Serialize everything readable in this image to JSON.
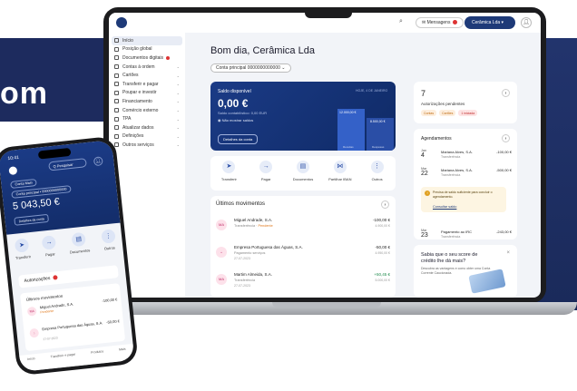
{
  "hero_text": "om",
  "topbar": {
    "search_icon": "search-icon",
    "messages_label": "Mensagens",
    "account_label": "Cerâmica Lda",
    "user_icon": "user-icon"
  },
  "sidebar": {
    "items": [
      {
        "label": "Início",
        "icon": "home-icon"
      },
      {
        "label": "Posição global",
        "icon": "globe-icon"
      },
      {
        "label": "Documentos digitais",
        "icon": "document-icon",
        "badge": true
      },
      {
        "label": "Contas à ordem",
        "icon": "bank-icon",
        "chevron": true
      },
      {
        "label": "Cartões",
        "icon": "card-icon",
        "chevron": true
      },
      {
        "label": "Transferir e pagar",
        "icon": "transfer-icon",
        "chevron": true
      },
      {
        "label": "Poupar e investir",
        "icon": "savings-icon",
        "chevron": true
      },
      {
        "label": "Financiamento",
        "icon": "finance-icon",
        "chevron": true
      },
      {
        "label": "Comércio externo",
        "icon": "trade-icon",
        "chevron": true
      },
      {
        "label": "TPA",
        "icon": "pos-icon",
        "chevron": true
      },
      {
        "label": "Atualizar dados",
        "icon": "refresh-icon",
        "chevron": true
      },
      {
        "label": "Definições",
        "icon": "gear-icon",
        "chevron": true
      },
      {
        "label": "Outros serviços",
        "icon": "more-icon",
        "chevron": true
      }
    ]
  },
  "main": {
    "greeting": "Bom dia, Cerâmica Lda",
    "account_select": "Conta principal 0000000000000"
  },
  "balance": {
    "label": "Saldo disponível",
    "amount": "0,00 €",
    "sub": "Saldo contabilístico: 0,00 EUR",
    "hide": "Não mostrar saldos",
    "details": "Detalhes da conta",
    "date": "HOJE, 4 DE JANEIRO",
    "bar1_value": "12.000,00 €",
    "bar2_value": "8.500,00 €",
    "bar1_label": "Receitas",
    "bar2_label": "Despesas"
  },
  "actions": [
    {
      "label": "Transferir",
      "icon": "send-icon"
    },
    {
      "label": "Pagar",
      "icon": "arrow-right-icon"
    },
    {
      "label": "Documentos",
      "icon": "document-icon"
    },
    {
      "label": "Partilhar IBAN",
      "icon": "share-icon"
    },
    {
      "label": "Outros",
      "icon": "more-icon"
    }
  ],
  "movements": {
    "title": "Últimos movimentos",
    "rows": [
      {
        "avatar": "MA",
        "name": "Miguel Andrade, S.A.",
        "type": "Transferência",
        "status": "Pendente",
        "date": "",
        "value": "-100,00 €",
        "balance": "4.900,00 €",
        "positive": false
      },
      {
        "avatar": "",
        "name": "Empresa Portuguesa das Águas, S.A.",
        "type": "Pagamento serviços",
        "status": "",
        "date": "27-07-2023",
        "value": "-50,00 €",
        "balance": "4.950,00 €",
        "positive": false
      },
      {
        "avatar": "MA",
        "name": "Martim Almeida, S.A.",
        "type": "Transferência",
        "status": "",
        "date": "27-07-2023",
        "value": "+50,45 €",
        "balance": "5.000,00 €",
        "positive": true
      }
    ]
  },
  "authorizations": {
    "count": "7",
    "label": "Autorizações pendentes",
    "tags": [
      "Contas",
      "Cartões",
      "1 iniciada"
    ]
  },
  "schedule": {
    "title": "Agendamentos",
    "rows": [
      {
        "month": "Jan",
        "day": "4",
        "name": "Mariana Alves, S.A.",
        "type": "Transferência",
        "value": "-100,00 €"
      },
      {
        "month": "Mar",
        "day": "22",
        "name": "Mariana Alves, S.A.",
        "type": "Transferência",
        "value": "-500,00 €"
      },
      {
        "month": "Mar",
        "day": "23",
        "name": "Pagamento ao IRC",
        "type": "Transferência",
        "value": "-243,00 €"
      }
    ],
    "warning": "Precisa de saldo suficiente para concluir o agendamento.",
    "warning_link": "Consultar saldo"
  },
  "promo": {
    "title": "Sabia que o seu score de crédito lhe dá mais?",
    "text": "Descubra as vantagens e como obter uma Conta Corrente Caucionada."
  },
  "phone": {
    "time": "10:41",
    "search": "Q Pesquisar",
    "chip1": "Conta Main",
    "chip2": "Conta principal • 0000000000000",
    "amount": "5 043,50 €",
    "details": "Detalhes da conta",
    "actions": [
      {
        "label": "Transferir",
        "icon": "send-icon"
      },
      {
        "label": "Pagar",
        "icon": "arrow-right-icon"
      },
      {
        "label": "Documentos",
        "icon": "document-icon"
      },
      {
        "label": "Outros",
        "icon": "more-icon"
      }
    ],
    "auth_label": "Autorizações",
    "mov_title": "Últimos movimentos",
    "rows": [
      {
        "avatar": "MA",
        "name": "Miguel Andrade, S.A.",
        "status": "Pendente",
        "date": "",
        "value": "-100,00 €"
      },
      {
        "avatar": "",
        "name": "Empresa Portuguesa das Águas, S.A.",
        "status": "",
        "date": "27-07-2023",
        "value": "-50,00 €"
      }
    ],
    "nav": [
      "Início",
      "Transferir e pagar",
      "Produtos",
      "Mais"
    ]
  }
}
